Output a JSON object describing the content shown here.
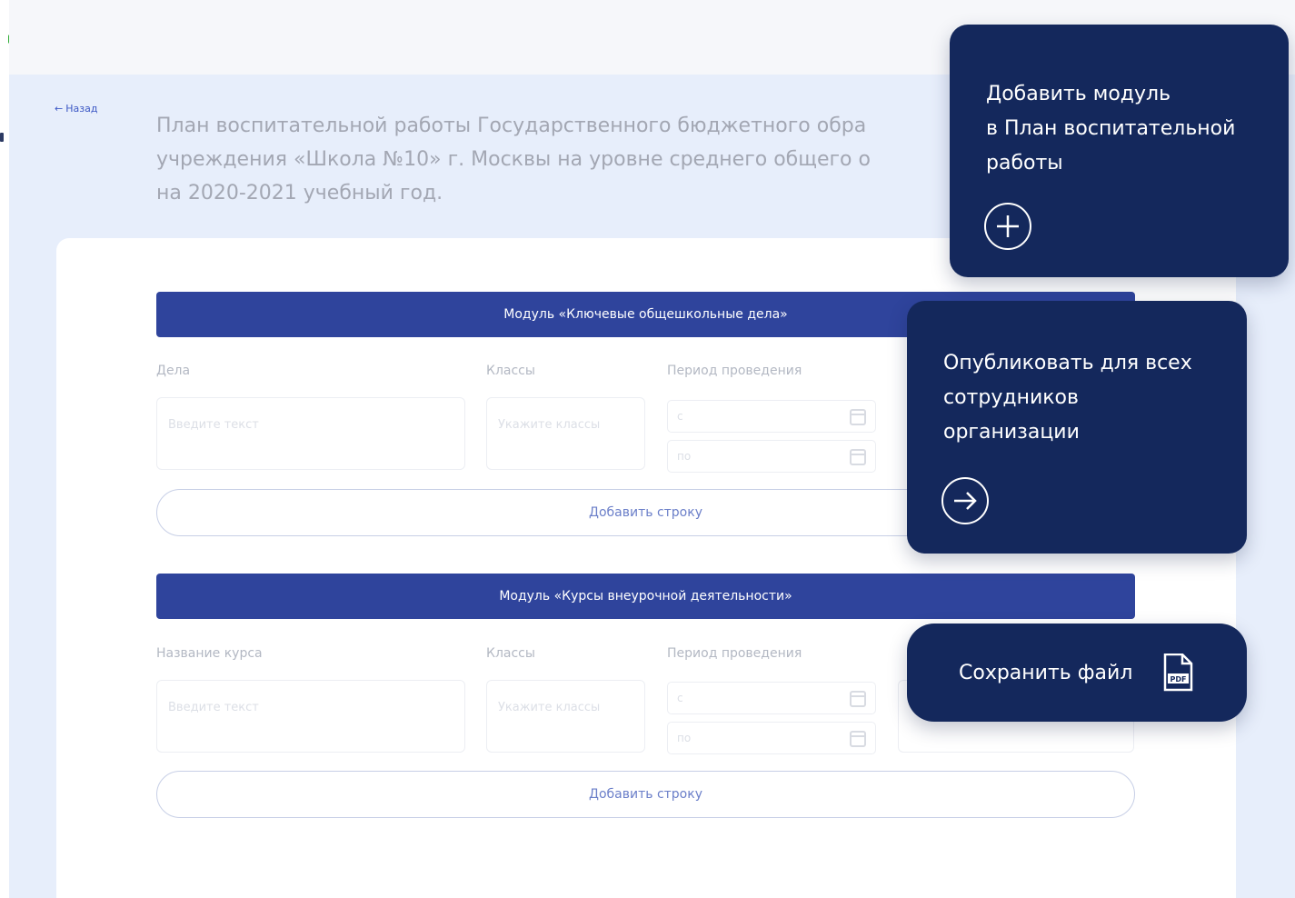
{
  "header": {
    "back_label": "Назад",
    "title_lines": [
      "План воспитательной работы Государственного бюджетного обра",
      "учреждения «Школа №10» г. Москвы на уровне среднего общего о",
      "на 2020-2021 учебный год."
    ]
  },
  "modules": [
    {
      "title": "Модуль «Ключевые общешкольные дела»",
      "columns": [
        "Дела",
        "Классы",
        "Период проведения"
      ],
      "text_placeholder": "Введите текст",
      "classes_placeholder": "Укажите классы",
      "date_from": "с",
      "date_to": "по",
      "add_row_label": "Добавить строку"
    },
    {
      "title": "Модуль «Курсы внеурочной деятельности»",
      "columns": [
        "Название курса",
        "Классы",
        "Период проведения"
      ],
      "text_placeholder": "Введите текст",
      "classes_placeholder": "Укажите классы",
      "date_from": "с",
      "date_to": "по",
      "add_row_label": "Добавить строку"
    }
  ],
  "tooltips": {
    "add_module": {
      "lines": [
        "Добавить модуль",
        "в План воспитательной",
        "работы"
      ],
      "icon": "plus-circle-icon"
    },
    "publish": {
      "lines": [
        "Опубликовать для всех",
        "сотрудников",
        "организации"
      ],
      "icon": "arrow-right-circle-icon"
    },
    "save": {
      "label": "Сохранить файл",
      "icon": "pdf-file-icon",
      "icon_text": "PDF"
    }
  },
  "colors": {
    "tooltip_bg": "#14285c",
    "module_header_bg": "#243a97",
    "page_bg": "#e7eefb"
  }
}
